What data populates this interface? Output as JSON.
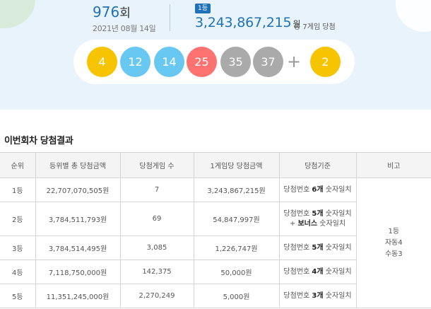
{
  "draw": {
    "round_number": "976",
    "round_unit": "회",
    "date": "2021년 08월 14일",
    "first_rank_badge": "1등",
    "first_prize_amount": "3,243,867,215",
    "first_prize_unit": "원",
    "first_prize_games": "총 7게임 당첨"
  },
  "balls": [
    {
      "number": "4",
      "color": "#f6c400"
    },
    {
      "number": "12",
      "color": "#69c8f2"
    },
    {
      "number": "14",
      "color": "#69c8f2"
    },
    {
      "number": "25",
      "color": "#ff7272"
    },
    {
      "number": "35",
      "color": "#aaaaaa"
    },
    {
      "number": "37",
      "color": "#aaaaaa"
    }
  ],
  "plus_symbol": "+",
  "bonus_ball": {
    "number": "2",
    "color": "#f6c400"
  },
  "results": {
    "section_title": "이번회차 당첨결과",
    "headers": [
      "순위",
      "등위별 총 당첨금액",
      "당첨게임 수",
      "1게임당 당첨금액",
      "당첨기준",
      "비고"
    ],
    "rows": [
      {
        "rank": "1등",
        "total": "22,707,070,505원",
        "games": "7",
        "per_game": "3,243,867,215원",
        "crit_pre": "당첨번호 ",
        "crit_bold": "6개",
        "crit_post": " 숫자일치",
        "crit_line2_bold": "",
        "crit_line2_post": ""
      },
      {
        "rank": "2등",
        "total": "3,784,511,793원",
        "games": "69",
        "per_game": "54,847,997원",
        "crit_pre": "당첨번호 ",
        "crit_bold": "5개",
        "crit_post": " 숫자일치",
        "crit_line2_pre": "+ ",
        "crit_line2_bold": "보너스",
        "crit_line2_post": " 숫자일치"
      },
      {
        "rank": "3등",
        "total": "3,784,514,495원",
        "games": "3,085",
        "per_game": "1,226,747원",
        "crit_pre": "당첨번호 ",
        "crit_bold": "5개",
        "crit_post": " 숫자일치",
        "crit_line2_bold": "",
        "crit_line2_post": ""
      },
      {
        "rank": "4등",
        "total": "7,118,750,000원",
        "games": "142,375",
        "per_game": "50,000원",
        "crit_pre": "당첨번호 ",
        "crit_bold": "4개",
        "crit_post": " 숫자일치",
        "crit_line2_bold": "",
        "crit_line2_post": ""
      },
      {
        "rank": "5등",
        "total": "11,351,245,000원",
        "games": "2,270,249",
        "per_game": "5,000원",
        "crit_pre": "당첨번호 ",
        "crit_bold": "3개",
        "crit_post": " 숫자일치",
        "crit_line2_bold": "",
        "crit_line2_post": ""
      }
    ],
    "note": {
      "line1": "1등",
      "line2": "자동4",
      "line3": "수동3"
    }
  }
}
